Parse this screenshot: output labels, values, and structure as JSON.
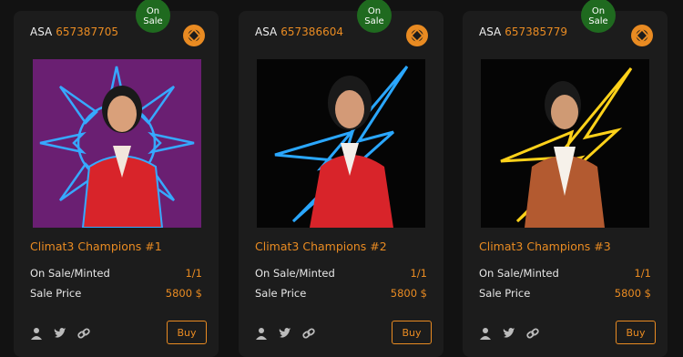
{
  "cards": [
    {
      "badge": "On\nSale",
      "asa_label": "ASA",
      "asa_id": "657387705",
      "title": "Climat3 Champions #1",
      "minted_label": "On Sale/Minted",
      "minted_value": "1/1",
      "price_label": "Sale Price",
      "price_value": "5800 $",
      "buy_label": "Buy",
      "art": {
        "bg": "#6a1f72",
        "glow": "#36a9ff",
        "shape": "sun"
      }
    },
    {
      "badge": "On\nSale",
      "asa_label": "ASA",
      "asa_id": "657386604",
      "title": "Climat3 Champions #2",
      "minted_label": "On Sale/Minted",
      "minted_value": "1/1",
      "price_label": "Sale Price",
      "price_value": "5800 $",
      "buy_label": "Buy",
      "art": {
        "bg": "#050505",
        "glow": "#2aa7ff",
        "shape": "bolt"
      }
    },
    {
      "badge": "On\nSale",
      "asa_label": "ASA",
      "asa_id": "657385779",
      "title": "Climat3 Champions #3",
      "minted_label": "On Sale/Minted",
      "minted_value": "1/1",
      "price_label": "Sale Price",
      "price_value": "5800 $",
      "buy_label": "Buy",
      "art": {
        "bg": "#050505",
        "glow": "#ffd21a",
        "shape": "bolt"
      }
    }
  ],
  "colors": {
    "accent": "#e98b22",
    "badge": "#1f6a1f",
    "card": "#1c1c1c",
    "background": "#121212"
  },
  "icons": [
    "user-icon",
    "twitter-icon",
    "link-icon",
    "shutter-logo-icon"
  ]
}
